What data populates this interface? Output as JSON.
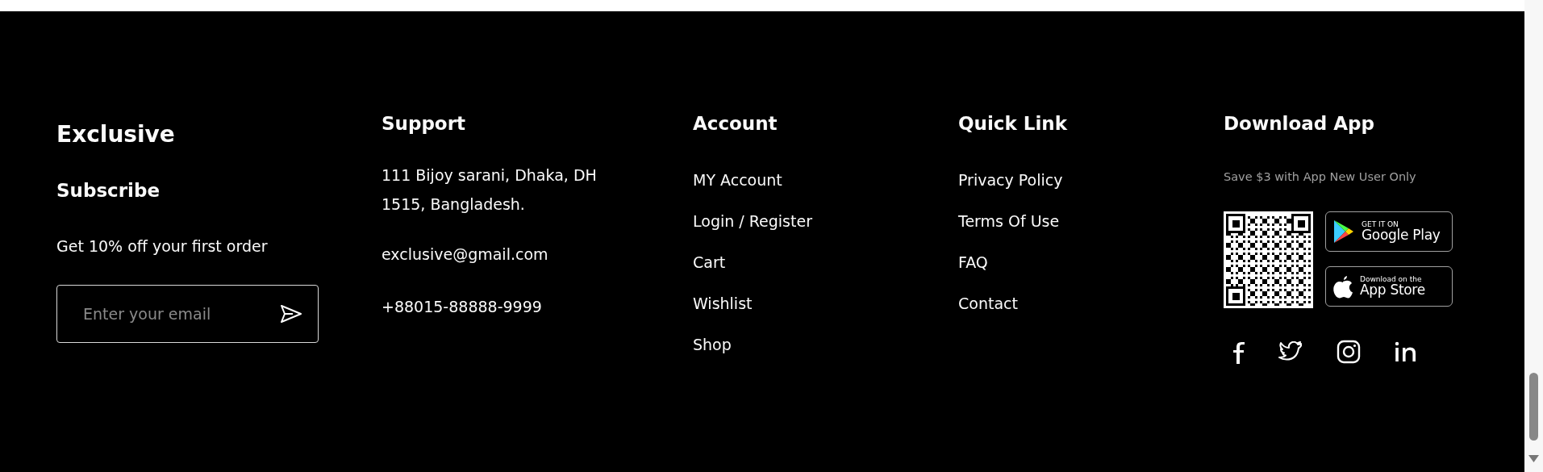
{
  "brand": {
    "title": "Exclusive",
    "subtitle": "Subscribe",
    "offer": "Get 10% off your first order",
    "email_field": {
      "placeholder": "Enter your email"
    }
  },
  "support": {
    "title": "Support",
    "address": "111 Bijoy sarani, Dhaka, DH 1515, Bangladesh.",
    "email": "exclusive@gmail.com",
    "phone": "+88015-88888-9999"
  },
  "account": {
    "title": "Account",
    "links": [
      "MY Account",
      "Login / Register",
      "Cart",
      "Wishlist",
      "Shop"
    ]
  },
  "quick_link": {
    "title": "Quick Link",
    "links": [
      "Privacy Policy",
      "Terms Of Use",
      "FAQ",
      "Contact"
    ]
  },
  "download_app": {
    "title": "Download App",
    "note": "Save $3 with App New User Only",
    "badges": [
      {
        "kind": "google",
        "small": "GET IT ON",
        "large": "Google Play"
      },
      {
        "kind": "apple",
        "small": "Download on the",
        "large": "App Store"
      }
    ],
    "social": [
      {
        "kind": "facebook"
      },
      {
        "kind": "twitter"
      },
      {
        "kind": "instagram"
      },
      {
        "kind": "linkedin"
      }
    ]
  }
}
